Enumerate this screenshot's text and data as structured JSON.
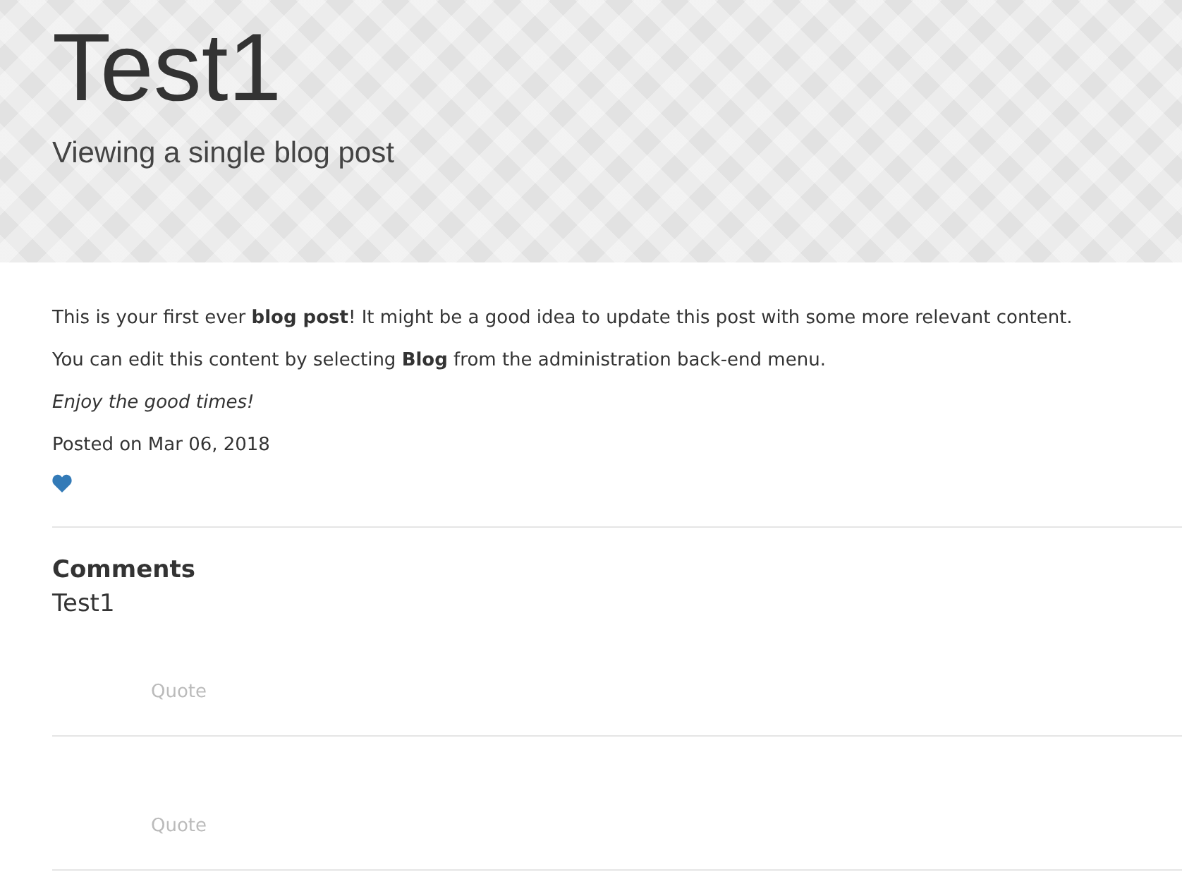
{
  "header": {
    "title": "Test1",
    "subtitle": "Viewing a single blog post"
  },
  "post": {
    "paragraphs": [
      {
        "kind": "plain",
        "text": "This is your first ever **blog post**! It might be a good idea to update this post with some more relevant content."
      },
      {
        "kind": "plain",
        "text": "You can edit this content by selecting **Blog** from the administration back-end menu."
      },
      {
        "kind": "emphasis",
        "text": "Enjoy the good times!"
      },
      {
        "kind": "plain",
        "text": "Posted on Mar 06, 2018"
      }
    ]
  },
  "comments": {
    "heading": "Comments",
    "items": [
      {
        "author": "Test1",
        "action": "Quote"
      },
      {
        "action": "Quote"
      }
    ]
  }
}
